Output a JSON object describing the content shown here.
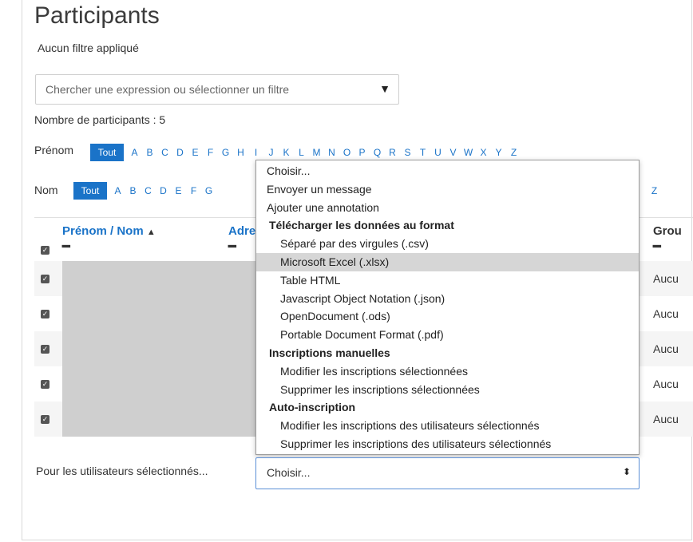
{
  "page": {
    "title": "Participants",
    "filter_status": "Aucun filtre appliqué",
    "search_placeholder": "Chercher une expression ou sélectionner un filtre",
    "count_text": "Nombre de participants : 5"
  },
  "initials": {
    "firstname_label": "Prénom",
    "lastname_label": "Nom",
    "all_label": "Tout",
    "firstname_letters": [
      "A",
      "B",
      "C",
      "D",
      "E",
      "F",
      "G",
      "H",
      "I",
      "J",
      "K",
      "L",
      "M",
      "N",
      "O",
      "P",
      "Q",
      "R",
      "S",
      "T",
      "U",
      "V",
      "W",
      "X",
      "Y",
      "Z"
    ],
    "lastname_letters_visible": [
      "A",
      "B",
      "C",
      "D",
      "E",
      "F",
      "G"
    ],
    "lastname_letter_tail": "Z"
  },
  "table": {
    "col_name": "Prénom / Nom",
    "col_address": "Adre",
    "col_groups": "Grou",
    "groups_value": "Aucu",
    "row_count": 5,
    "sort_icon": "caret-up-icon"
  },
  "dropdown": {
    "items": [
      {
        "type": "option",
        "label": "Choisir..."
      },
      {
        "type": "option",
        "label": "Envoyer un message"
      },
      {
        "type": "option",
        "label": "Ajouter une annotation"
      },
      {
        "type": "group",
        "label": "Télécharger les données au format"
      },
      {
        "type": "sub",
        "label": "Séparé par des virgules (.csv)"
      },
      {
        "type": "sub",
        "label": "Microsoft Excel (.xlsx)",
        "highlighted": true
      },
      {
        "type": "sub",
        "label": "Table HTML"
      },
      {
        "type": "sub",
        "label": "Javascript Object Notation (.json)"
      },
      {
        "type": "sub",
        "label": "OpenDocument (.ods)"
      },
      {
        "type": "sub",
        "label": "Portable Document Format (.pdf)"
      },
      {
        "type": "group",
        "label": "Inscriptions manuelles"
      },
      {
        "type": "sub",
        "label": "Modifier les inscriptions sélectionnées"
      },
      {
        "type": "sub",
        "label": "Supprimer les inscriptions sélectionnées"
      },
      {
        "type": "group",
        "label": "Auto-inscription"
      },
      {
        "type": "sub",
        "label": "Modifier les inscriptions des utilisateurs sélectionnés"
      },
      {
        "type": "sub",
        "label": "Supprimer les inscriptions des utilisateurs sélectionnés"
      }
    ]
  },
  "bulk": {
    "label": "Pour les utilisateurs sélectionnés...",
    "selected": "Choisir..."
  },
  "colors": {
    "accent": "#1a73c8",
    "highlight": "#d6d6d6"
  }
}
